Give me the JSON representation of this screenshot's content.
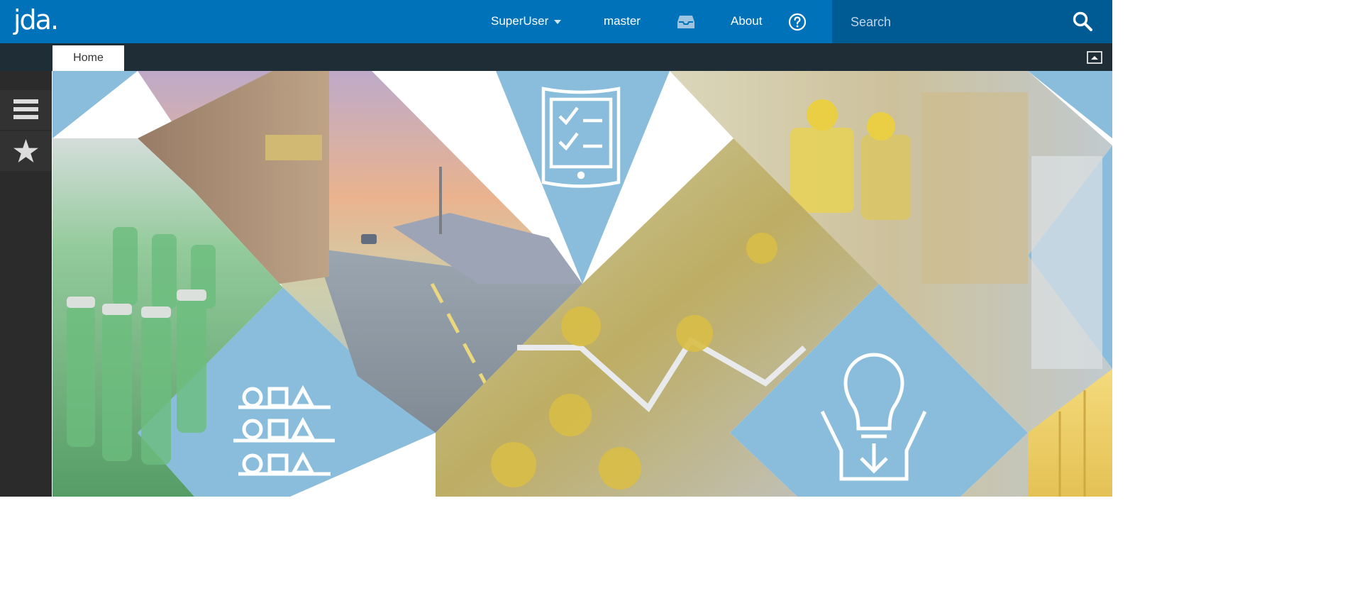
{
  "header": {
    "logo": "jda.",
    "user": "SuperUser",
    "instance": "master",
    "inbox_icon": "inbox-icon",
    "about": "About",
    "help_icon": "help-circle-icon",
    "search_placeholder": "Search",
    "search_icon": "search-icon",
    "brand_color": "#0072ba"
  },
  "tabs": [
    {
      "label": "Home",
      "active": true
    }
  ],
  "sidebar": {
    "items": [
      {
        "icon": "hamburger-menu-icon"
      },
      {
        "icon": "star-icon"
      }
    ]
  },
  "hero": {
    "tiles": [
      "truck-road-photo",
      "checklist-tablet-icon",
      "warehouse-workers-photo",
      "green-bottles-photo",
      "oil-capsules-photo",
      "shapes-rows-icon",
      "lightbulb-download-icon",
      "containers-photo"
    ],
    "accent_color": "#79b4d6"
  }
}
